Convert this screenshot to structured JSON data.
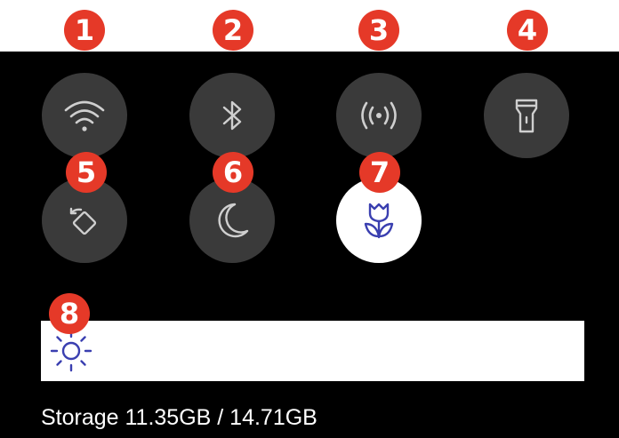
{
  "badges": [
    "1",
    "2",
    "3",
    "4",
    "5",
    "6",
    "7",
    "8"
  ],
  "tiles": [
    {
      "icon": "wifi-icon",
      "active": false
    },
    {
      "icon": "bluetooth-icon",
      "active": false
    },
    {
      "icon": "hotspot-icon",
      "active": false
    },
    {
      "icon": "flashlight-icon",
      "active": false
    },
    {
      "icon": "auto-rotate-icon",
      "active": false
    },
    {
      "icon": "do-not-disturb-moon-icon",
      "active": false
    },
    {
      "icon": "macro-tulip-icon",
      "active": true
    },
    {
      "icon": "brightness-sun-icon",
      "active": false
    }
  ],
  "storage": {
    "text": "Storage 11.35GB / 14.71GB"
  },
  "colors": {
    "background": "#000000",
    "tile": "#3a3a3a",
    "tile_active": "#ffffff",
    "badge": "#e53928",
    "icon_active": "#3a3fb0",
    "icon_inactive": "#cfcfcf"
  }
}
